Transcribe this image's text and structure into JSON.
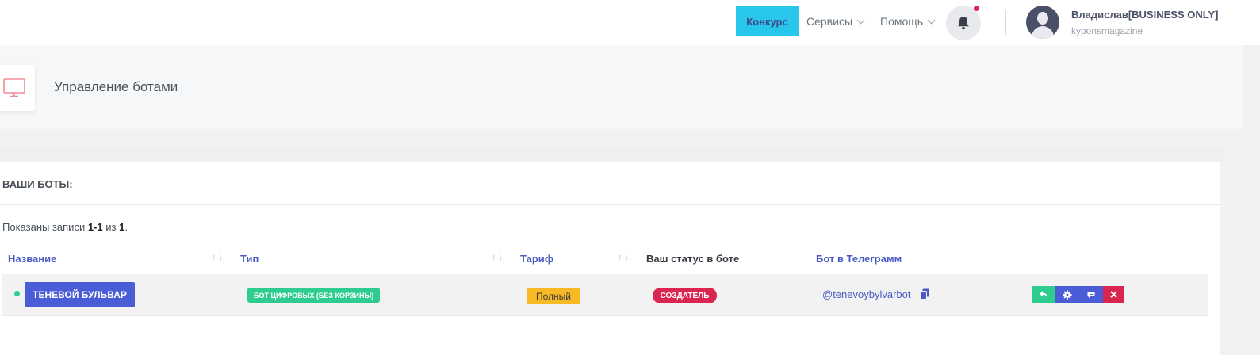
{
  "header": {
    "contest_label": "Конкурс",
    "services_label": "Сервисы",
    "help_label": "Помощь",
    "notification_icon": "bell-icon",
    "user": {
      "name": "Владислав[BUSINESS ONLY]",
      "login": "kyponsmagazine"
    }
  },
  "page": {
    "title": "Управление ботами",
    "icon": "monitor-icon"
  },
  "card": {
    "title": "Ваши боты:",
    "summary_prefix": "Показаны записи ",
    "summary_range": "1-1",
    "summary_mid": " из ",
    "summary_total": "1",
    "summary_suffix": "."
  },
  "table": {
    "columns": {
      "name": "Название",
      "type": "Тип",
      "tariff": "Тариф",
      "status": "Ваш статус в боте",
      "telegram": "Бот в Телеграмм"
    },
    "sort_arrows": "↑↓",
    "rows": [
      {
        "name": "ТЕНЕВОЙ БУЛЬВАР",
        "type": "БОТ ЦИФРОВЫХ (БЕЗ КОРЗИНЫ)",
        "tariff": "Полный",
        "status": "СОЗДАТЕЛЬ",
        "telegram": "@tenevoybylvarbot",
        "actions": [
          "reply-icon",
          "gear-icon",
          "retweet-icon",
          "close-icon"
        ]
      }
    ]
  },
  "colors": {
    "accent_blue": "#4a5cd6",
    "contest_cyan": "#27c6ea",
    "success_green": "#2ecc8f",
    "warning_yellow": "#f7b924",
    "danger_red": "#d92550"
  }
}
